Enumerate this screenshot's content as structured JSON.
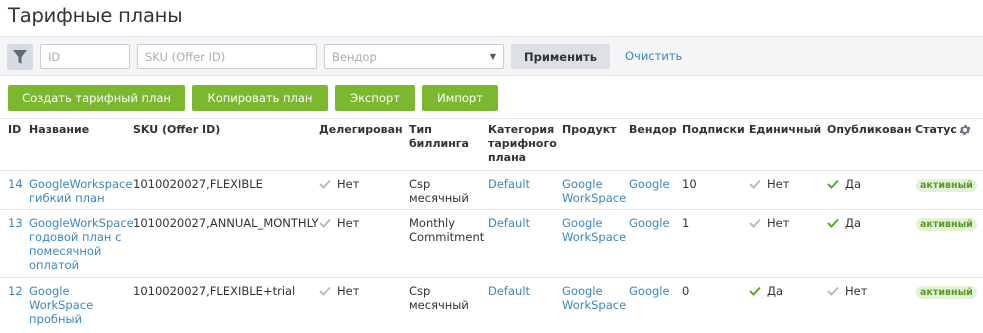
{
  "page": {
    "title": "Тарифные планы"
  },
  "filters": {
    "id_placeholder": "ID",
    "sku_placeholder": "SKU (Offer ID)",
    "vendor_placeholder": "Вендор",
    "apply_label": "Применить",
    "clear_label": "Очистить"
  },
  "actions": {
    "create": "Создать тарифный план",
    "copy": "Копировать план",
    "export": "Экспорт",
    "import": "Импорт"
  },
  "table": {
    "headers": {
      "id": "ID",
      "name": "Название",
      "sku": "SKU (Offer ID)",
      "delegated": "Делегирован",
      "billing_l1": "Тип",
      "billing_l2": "биллинга",
      "category_l1": "Категория",
      "category_l2": "тарифного",
      "category_l3": "плана",
      "product": "Продукт",
      "vendor": "Вендор",
      "subs": "Подписки",
      "single": "Единичный",
      "published": "Опубликован",
      "status": "Статус"
    },
    "rows": [
      {
        "id": "14",
        "name_l1": "GoogleWorkspace",
        "name_l2": "гибкий план",
        "sku": "1010020027,FLEXIBLE",
        "delegated": "Нет",
        "billing_l1": "Csp",
        "billing_l2": "месячный",
        "category": "Default",
        "product_l1": "Google",
        "product_l2": "WorkSpace",
        "vendor": "Google",
        "subs": "10",
        "single": "Нет",
        "published": "Да",
        "status": "активный"
      },
      {
        "id": "13",
        "name_l1": "GoogleWorkSpace",
        "name_l2": "годовой план с",
        "name_l3": "помесячной",
        "name_l4": "оплатой",
        "sku": "1010020027,ANNUAL_MONTHLY",
        "delegated": "Нет",
        "billing_l1": "Monthly",
        "billing_l2": "Commitment",
        "category": "Default",
        "product_l1": "Google",
        "product_l2": "WorkSpace",
        "vendor": "Google",
        "subs": "1",
        "single": "Нет",
        "published": "Да",
        "status": "активный"
      },
      {
        "id": "12",
        "name_l1": "Google",
        "name_l2": "WorkSpace",
        "name_l3": "пробный",
        "sku": "1010020027,FLEXIBLE+trial",
        "delegated": "Нет",
        "billing_l1": "Csp",
        "billing_l2": "месячный",
        "category": "Default",
        "product_l1": "Google",
        "product_l2": "WorkSpace",
        "vendor": "Google",
        "subs": "0",
        "single": "Да",
        "published": "Нет",
        "status": "активный"
      }
    ]
  },
  "colors": {
    "accent_green": "#7cb82f",
    "link_blue": "#3b86c4",
    "check_grey": "#b8bdc2",
    "check_green": "#5aa832"
  }
}
